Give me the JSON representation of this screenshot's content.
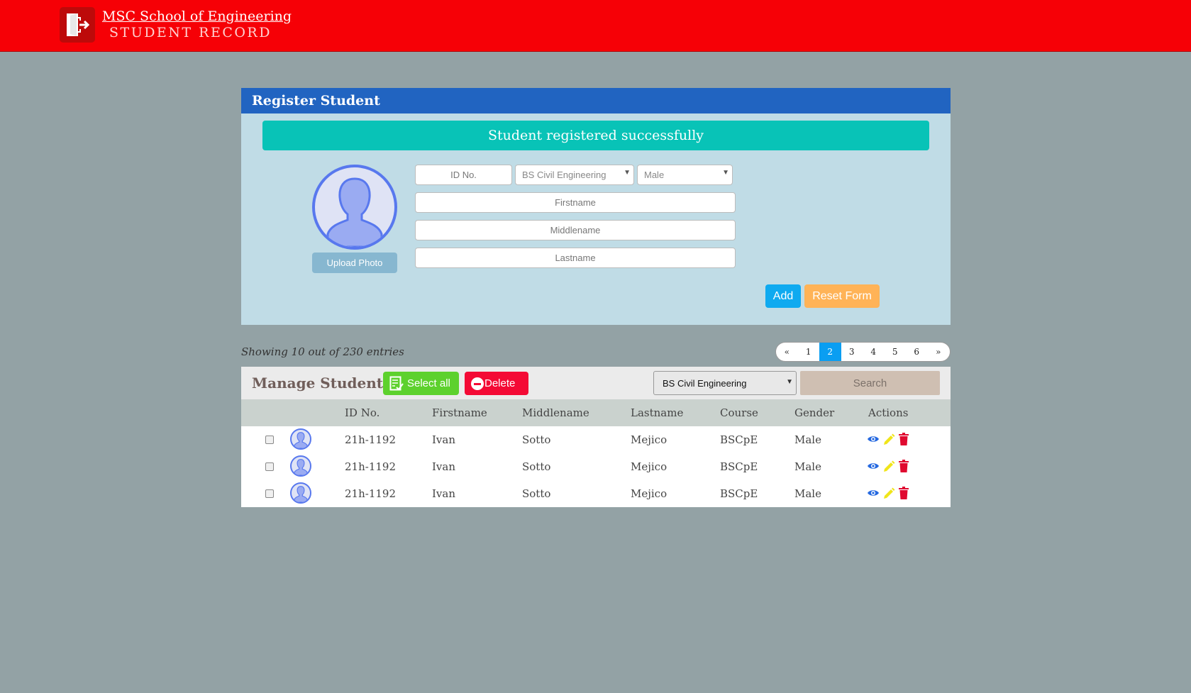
{
  "header": {
    "school_name": "MSC School of Engineering",
    "subtitle": "STUDENT RECORD",
    "logo_icon": "exit-door-icon"
  },
  "register": {
    "title": "Register Student",
    "alert": "Student registered successfully",
    "upload_label": "Upload Photo",
    "id_placeholder": "ID No.",
    "course_value": "BS Civil Engineering",
    "gender_value": "Male",
    "firstname_placeholder": "Firstname",
    "middlename_placeholder": "Middlename",
    "lastname_placeholder": "Lastname",
    "add_label": "Add",
    "reset_label": "Reset Form"
  },
  "listing": {
    "showing": "Showing 10 out of 230 entries",
    "pagination": [
      "«",
      "1",
      "2",
      "3",
      "4",
      "5",
      "6",
      "»"
    ],
    "active_page": "2",
    "manage_title": "Manage Students",
    "select_all_label": "Select all",
    "delete_label": "Delete",
    "course_filter": "BS Civil Engineering",
    "search_label": "Search",
    "columns": [
      "ID No.",
      "Firstname",
      "Middlename",
      "Lastname",
      "Course",
      "Gender",
      "Actions"
    ],
    "rows": [
      {
        "id": "21h-1192",
        "firstname": "Ivan",
        "middlename": "Sotto",
        "lastname": "Mejico",
        "course": "BSCpE",
        "gender": "Male"
      },
      {
        "id": "21h-1192",
        "firstname": "Ivan",
        "middlename": "Sotto",
        "lastname": "Mejico",
        "course": "BSCpE",
        "gender": "Male"
      },
      {
        "id": "21h-1192",
        "firstname": "Ivan",
        "middlename": "Sotto",
        "lastname": "Mejico",
        "course": "BSCpE",
        "gender": "Male"
      }
    ]
  },
  "colors": {
    "header": "#f60006",
    "panel_header": "#2164c1",
    "alert": "#08c3b7",
    "add": "#0faaf0",
    "reset": "#ffb357",
    "select_all": "#5dd12d",
    "delete": "#f40a35",
    "active_page": "#0a9ef2"
  },
  "icons": {
    "view": "eye-icon",
    "edit": "pencil-icon",
    "remove": "trash-icon"
  }
}
